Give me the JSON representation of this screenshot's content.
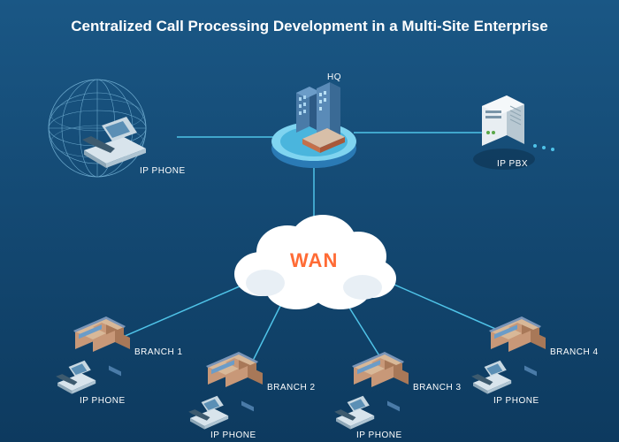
{
  "title": "Centralized Call Processing Development in a Multi-Site Enterprise",
  "hq": {
    "label": "HQ"
  },
  "ipphone_globe": {
    "label": "IP PHONE"
  },
  "ippbx": {
    "label": "IP PBX"
  },
  "wan": {
    "label": "WAN"
  },
  "branches": [
    {
      "name": "BRANCH 1",
      "phone": "IP PHONE"
    },
    {
      "name": "BRANCH 2",
      "phone": "IP PHONE"
    },
    {
      "name": "BRANCH 3",
      "phone": "IP PHONE"
    },
    {
      "name": "BRANCH 4",
      "phone": "IP PHONE"
    }
  ]
}
